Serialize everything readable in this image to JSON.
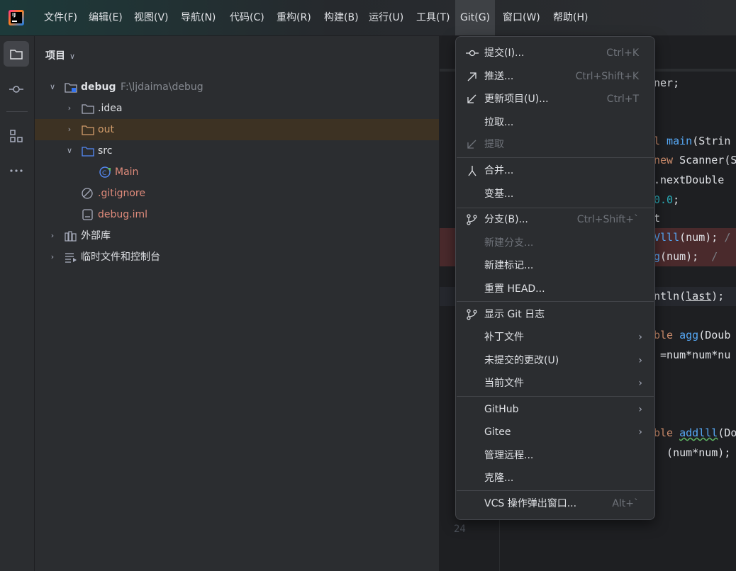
{
  "menubar": {
    "items": [
      "文件(F)",
      "编辑(E)",
      "视图(V)",
      "导航(N)",
      "代码(C)",
      "重构(R)",
      "构建(B)",
      "运行(U)",
      "工具(T)",
      "Git(G)",
      "窗口(W)",
      "帮助(H)"
    ],
    "active": "Git(G)"
  },
  "toolstrip": {
    "icons": [
      "project-icon",
      "commit-icon",
      "structure-icon",
      "more-icon"
    ]
  },
  "project": {
    "title": "项目",
    "tree": [
      {
        "name": "debug",
        "path": "F:\\ljdaima\\debug",
        "icon": "module-folder-icon",
        "expanded": true
      },
      {
        "name": ".idea",
        "icon": "folder-icon",
        "expanded": false
      },
      {
        "name": "out",
        "icon": "folder-excluded-icon",
        "expanded": false,
        "highlighted": true
      },
      {
        "name": "src",
        "icon": "source-folder-icon",
        "expanded": true
      },
      {
        "name": "Main",
        "icon": "java-class-icon"
      },
      {
        "name": ".gitignore",
        "icon": "ignore-file-icon"
      },
      {
        "name": "debug.iml",
        "icon": "iml-file-icon"
      },
      {
        "name": "外部库",
        "icon": "library-icon",
        "expanded": false
      },
      {
        "name": "临时文件和控制台",
        "icon": "scratches-icon",
        "expanded": false
      }
    ]
  },
  "editor": {
    "lines": {
      "l1": "ner;",
      "l2_kw": "l",
      "l2_fn": " main",
      "l2_rest": "(Strin",
      "l3_kw": "new",
      "l3_rest": " Scanner(S",
      "l4": ".nextDouble",
      "l5": "0.0",
      "l5b": ";",
      "l6": "t",
      "l7a": "Vlll",
      "l7b": "(num);",
      "l7c": " /",
      "l8a": "g",
      "l8b": "(num);",
      "l8c": "  /",
      "l9a": "ntln(",
      "l9b": "last",
      "l9c": ");",
      "l10a": "ble ",
      "l10b": "agg",
      "l10c": "(Doub",
      "l11": " =num*num*nu",
      "l12a": "ble ",
      "l12b": "addlll",
      "l12c": "(Do",
      "l13": "  (num*num);",
      "linenum": "24"
    }
  },
  "git_menu": {
    "items": [
      {
        "label": "提交(I)...",
        "shortcut": "Ctrl+K",
        "icon": "commit-icon"
      },
      {
        "label": "推送...",
        "shortcut": "Ctrl+Shift+K",
        "icon": "push-icon"
      },
      {
        "label": "更新项目(U)...",
        "shortcut": "Ctrl+T",
        "icon": "update-icon"
      },
      {
        "label": "拉取..."
      },
      {
        "label": "提取",
        "disabled": true,
        "icon": "fetch-icon"
      },
      {
        "label": "合并...",
        "icon": "merge-icon"
      },
      {
        "label": "变基..."
      },
      {
        "label": "分支(B)...",
        "shortcut": "Ctrl+Shift+`",
        "icon": "branch-icon"
      },
      {
        "label": "新建分支...",
        "disabled": true
      },
      {
        "label": "新建标记..."
      },
      {
        "label": "重置 HEAD..."
      },
      {
        "label": "显示 Git 日志",
        "icon": "git-log-icon"
      },
      {
        "label": "补丁文件",
        "submenu": true
      },
      {
        "label": "未提交的更改(U)",
        "submenu": true
      },
      {
        "label": "当前文件",
        "submenu": true
      },
      {
        "label": "GitHub",
        "submenu": true
      },
      {
        "label": "Gitee",
        "submenu": true
      },
      {
        "label": "管理远程..."
      },
      {
        "label": "克隆..."
      },
      {
        "label": "VCS 操作弹出窗口...",
        "shortcut": "Alt+`"
      }
    ],
    "submenu_glyph": "›"
  }
}
